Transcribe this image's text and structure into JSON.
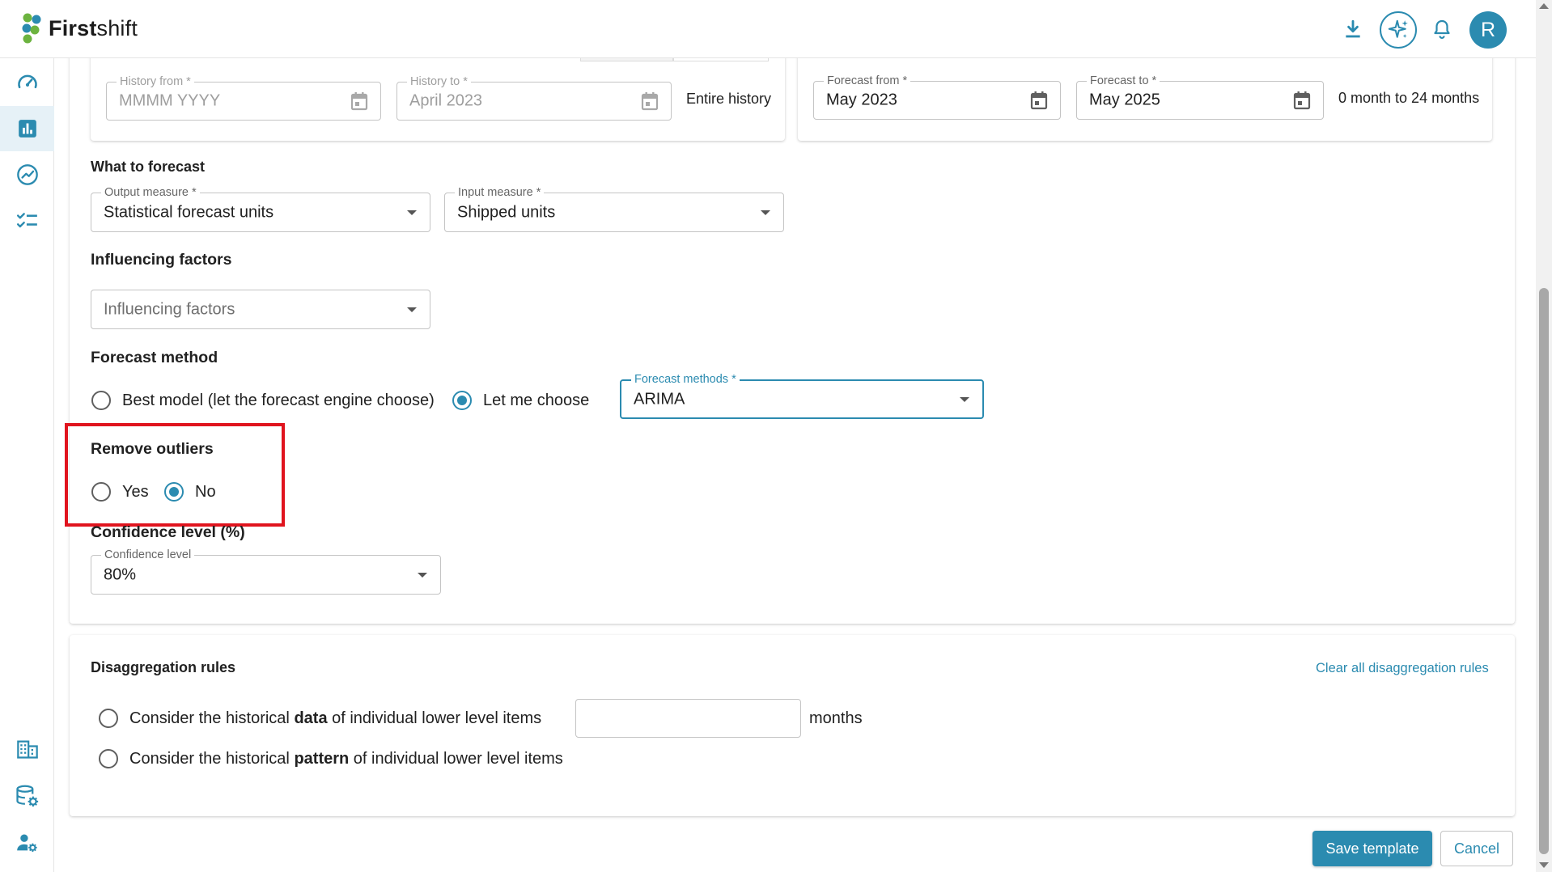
{
  "header": {
    "logo_text_bold": "First",
    "logo_text_light": "shift",
    "avatar_initial": "R"
  },
  "history": {
    "from_label": "History from *",
    "from_placeholder": "MMMM YYYY",
    "to_label": "History to *",
    "to_value": "April 2023",
    "entire_history": "Entire history"
  },
  "forecast_period": {
    "from_label": "Forecast from *",
    "from_value": "May 2023",
    "to_label": "Forecast to *",
    "to_value": "May 2025",
    "range_note": "0 month to 24 months"
  },
  "what_to_forecast": {
    "title": "What to forecast",
    "output_label": "Output measure *",
    "output_value": "Statistical forecast units",
    "input_label": "Input measure *",
    "input_value": "Shipped units"
  },
  "influencing_factors": {
    "title": "Influencing factors",
    "placeholder": "Influencing factors"
  },
  "forecast_method": {
    "title": "Forecast method",
    "option_best": "Best model (let the forecast engine choose)",
    "option_choose": "Let me choose",
    "selected": "Let me choose",
    "methods_label": "Forecast methods *",
    "methods_value": "ARIMA"
  },
  "remove_outliers": {
    "title": "Remove outliers",
    "option_yes": "Yes",
    "option_no": "No",
    "selected": "No"
  },
  "confidence": {
    "title": "Confidence level (%)",
    "label": "Confidence level",
    "value": "80%"
  },
  "disaggregation": {
    "title": "Disaggregation rules",
    "clear_link": "Clear all disaggregation rules",
    "rule1_prefix": "Consider the historical ",
    "rule1_bold": "data",
    "rule1_suffix": " of individual lower level items",
    "months_value": "",
    "months_unit": "months",
    "rule2_prefix": "Consider the historical ",
    "rule2_bold": "pattern",
    "rule2_suffix": " of individual lower level items"
  },
  "actions": {
    "save": "Save template",
    "cancel": "Cancel"
  },
  "colors": {
    "accent": "#2b8bb0",
    "highlight": "#e0141e",
    "logo_green": "#6cb33f",
    "logo_teal": "#2b8bb0"
  },
  "icons": {
    "header": [
      "download-icon",
      "sparkle-ai-icon",
      "bell-icon"
    ],
    "sidebar": [
      "dashboard-gauge-icon",
      "bar-chart-icon",
      "trend-icon",
      "checklist-icon",
      "building-icon",
      "database-settings-icon",
      "user-settings-icon"
    ]
  }
}
